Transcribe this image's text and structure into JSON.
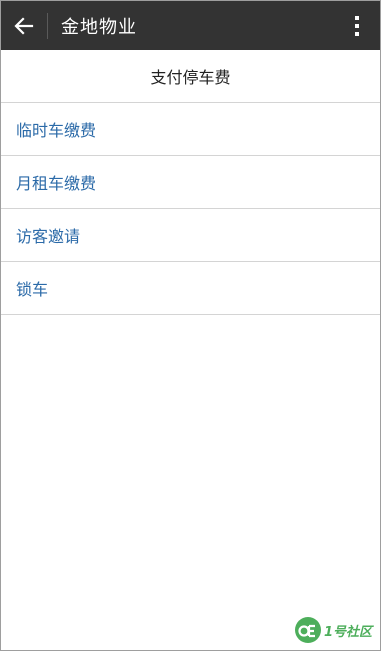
{
  "header": {
    "title": "金地物业",
    "back_icon": "arrow-left-icon",
    "overflow_icon": "more-vertical-icon",
    "bg_color": "#333333"
  },
  "section": {
    "title": "支付停车费"
  },
  "menu": {
    "items": [
      {
        "label": "临时车缴费"
      },
      {
        "label": "月租车缴费"
      },
      {
        "label": "访客邀请"
      },
      {
        "label": "锁车"
      }
    ],
    "link_color": "#2b6aa8"
  },
  "watermark": {
    "text": "1号社区",
    "logo_icon": "community-logo-icon",
    "color": "#3aa64a"
  }
}
